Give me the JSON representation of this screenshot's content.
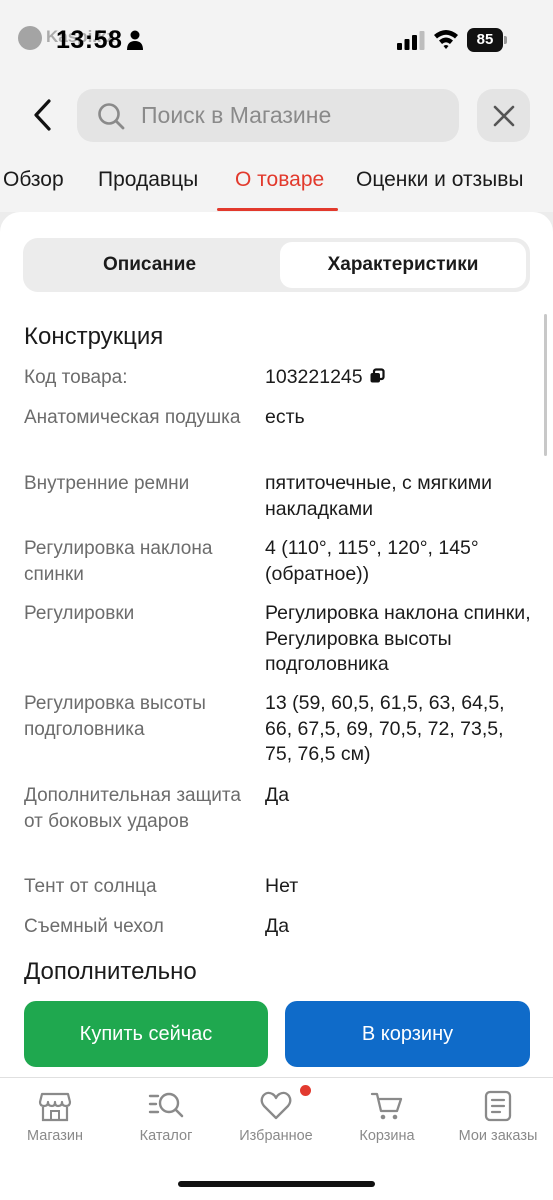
{
  "status_bar": {
    "time": "13:58",
    "logo_text": "Kaspi.kz",
    "battery": "85",
    "icons": [
      "person-icon",
      "signal-icon",
      "wifi-icon",
      "battery-icon"
    ]
  },
  "search": {
    "placeholder": "Поиск в Магазине",
    "icons": [
      "back-icon",
      "search-icon",
      "close-icon"
    ]
  },
  "tabs": [
    {
      "label": "Обзор",
      "active": false
    },
    {
      "label": "Продавцы",
      "active": false
    },
    {
      "label": "О товаре",
      "active": true
    },
    {
      "label": "Оценки и отзывы",
      "active": false
    }
  ],
  "segmented": {
    "description": "Описание",
    "specs": "Характеристики",
    "selected": "Характеристики"
  },
  "sections": [
    {
      "title": "Конструкция",
      "rows": [
        {
          "key": "Код товара:",
          "value": "103221245"
        },
        {
          "key": "Анатомическая подушка",
          "value": "есть"
        },
        {
          "key": "Внутренние ремни",
          "value": "пятиточечные, с мягкими накладками"
        },
        {
          "key": "Регулировка наклона спинки",
          "value": "4 (110°, 115°, 120°, 145° (обратное))"
        },
        {
          "key": "Регулировки",
          "value": "Регулировка наклона спинки, Регулировка высоты подголовника"
        },
        {
          "key": "Регулировка высоты подголовника",
          "value": "13 (59, 60,5, 61,5, 63, 64,5, 66, 67,5, 69, 70,5, 72, 73,5, 75, 76,5 см)"
        },
        {
          "key": "Дополнительная защита от боковых ударов",
          "value": "Да"
        },
        {
          "key": "Тент от солнца",
          "value": "Нет"
        },
        {
          "key": "Съемный чехол",
          "value": "Да"
        }
      ]
    },
    {
      "title": "Дополнительно",
      "rows": []
    }
  ],
  "actions": {
    "buy_now": "Купить сейчас",
    "add_to_cart": "В корзину"
  },
  "bottom_nav": [
    {
      "label": "Магазин",
      "icon": "shop-icon"
    },
    {
      "label": "Каталог",
      "icon": "catalog-icon"
    },
    {
      "label": "Избранное",
      "icon": "heart-icon",
      "badge": true
    },
    {
      "label": "Корзина",
      "icon": "cart-icon"
    },
    {
      "label": "Мои заказы",
      "icon": "orders-icon"
    }
  ],
  "colors": {
    "accent": "#e2392c",
    "buy": "#1fa84f",
    "cart": "#0f6bc9"
  }
}
